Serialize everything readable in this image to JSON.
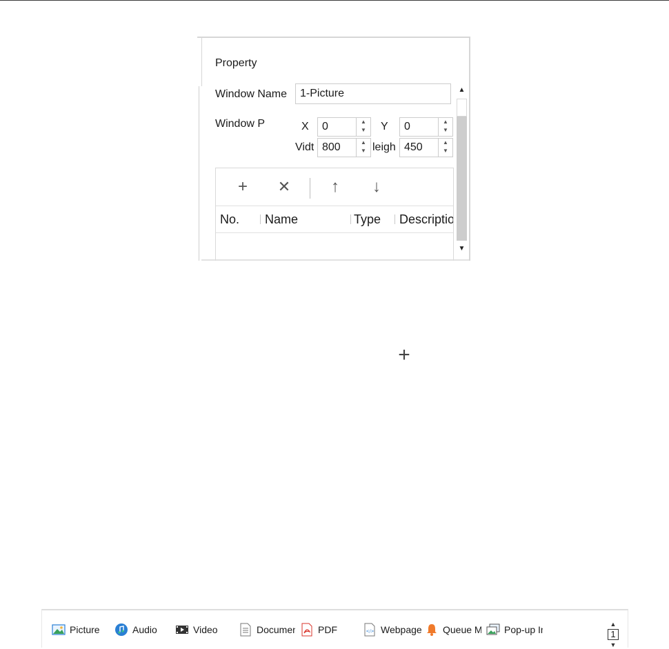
{
  "panel": {
    "title": "Property",
    "window_name_label": "Window Name",
    "window_name_value": "1-Picture",
    "window_pos_label": "Window P",
    "x_label": "X",
    "x_value": "0",
    "y_label": "Y",
    "y_value": "0",
    "width_label": "Vidt",
    "width_value": "800",
    "height_label": "leigh",
    "height_value": "450",
    "columns": [
      "No.",
      "Name",
      "Type",
      "Descriptio"
    ],
    "toolbar_icons": [
      "add-icon",
      "delete-icon",
      "move-up-icon",
      "move-down-icon"
    ]
  },
  "toolbar": {
    "items": [
      {
        "label": "Picture",
        "icon": "picture-icon"
      },
      {
        "label": "Audio",
        "icon": "audio-icon"
      },
      {
        "label": "Video",
        "icon": "video-icon"
      },
      {
        "label": "Documen",
        "icon": "document-icon"
      },
      {
        "label": "PDF",
        "icon": "pdf-icon"
      },
      {
        "label": "Webpage",
        "icon": "webpage-icon"
      },
      {
        "label": "Queue Ma",
        "icon": "bell-icon"
      },
      {
        "label": "Pop-up In",
        "icon": "popup-image-icon"
      }
    ],
    "page": "1"
  },
  "colors": {
    "pdf_red": "#d9342b",
    "bell_orange": "#f07a2b",
    "audio_blue": "#2a7fd4",
    "picture_green": "#3aa15c"
  }
}
